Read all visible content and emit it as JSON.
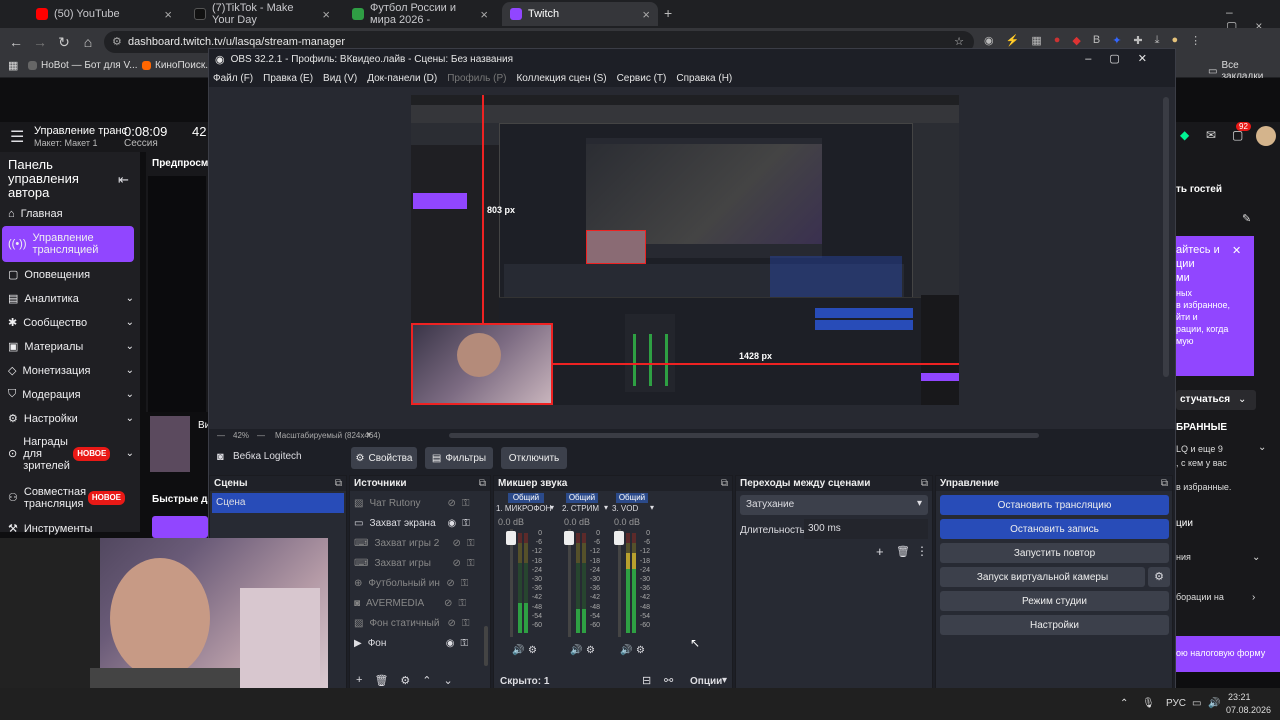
{
  "browser": {
    "tabs": [
      {
        "label": "(50) YouTube",
        "color": "#ff0000"
      },
      {
        "label": "(7)TikTok - Make Your Day",
        "color": "#111111"
      },
      {
        "label": "Футбол России и мира 2026 -",
        "color": "#2f9e44"
      },
      {
        "label": "Twitch",
        "color": "#9146ff"
      }
    ],
    "url": "dashboard.twitch.tv/u/lasqa/stream-manager",
    "bookmarks": [
      "HoBot — Бот для V...",
      "КиноПоиск.ru",
      "Все закладки"
    ]
  },
  "twitch": {
    "header_title": "Управление транс",
    "header_sub": "Макет: Макет 1",
    "session_time": "0:08:09",
    "session_label": "Сессия",
    "num42": "42",
    "preview_label": "Предпросм",
    "fast_label": "Быстрые де",
    "panel_title": "Панель управления автора",
    "side_items": [
      {
        "label": "Главная",
        "icon": "home-icon"
      },
      {
        "label": "Управление трансляцией",
        "icon": "stream-icon"
      },
      {
        "label": "Оповещения",
        "icon": "alert-icon"
      },
      {
        "label": "Аналитика",
        "icon": "chart-icon"
      },
      {
        "label": "Сообщество",
        "icon": "community-icon"
      },
      {
        "label": "Материалы",
        "icon": "content-icon"
      },
      {
        "label": "Монетизация",
        "icon": "money-icon"
      },
      {
        "label": "Модерация",
        "icon": "shield-icon"
      },
      {
        "label": "Настройки",
        "icon": "gear-icon"
      },
      {
        "label": "Награды для зрителей",
        "icon": "gift-icon"
      },
      {
        "label": "Совместная трансляция",
        "icon": "collab-icon"
      },
      {
        "label": "Инструменты",
        "icon": "tools-icon"
      }
    ],
    "new_badge": "НОВОЕ",
    "notifications": "92",
    "right_texts": {
      "guests": "ть гостей",
      "promo1": "айтесь и",
      "promo2": "ции",
      "promo3": "ми",
      "promo4": "ных",
      "promo5": "в избранное,",
      "promo6": "йти и",
      "promo7": "рации, когда",
      "promo8": "мую",
      "join": "стучаться",
      "fav": "БРАННЫЕ",
      "lq": "LQ и еще 9",
      "who": ", с кем у вас",
      "infav": "в избранные.",
      "tsii": "ции",
      "nia": "ния",
      "ration": "борации на",
      "tax": "ою налоговую форму"
    }
  },
  "obs": {
    "title": "OBS 32.2.1 - Профиль: ВКвидео.лайв - Сцены: Без названия",
    "menu": [
      "Файл (F)",
      "Правка (E)",
      "Вид (V)",
      "Док-панели (D)",
      "Профиль (P)",
      "Коллекция сцен (S)",
      "Сервис (T)",
      "Справка (H)"
    ],
    "dim_menu_index": 4,
    "preview_w": "803 px",
    "preview_h": "1428 px",
    "zoom": "42%",
    "scale_mode": "Масштабируемый (824x464)",
    "selected_source": "Вебка Logitech",
    "props_btn": "Свойства",
    "filters_btn": "Фильтры",
    "disable_btn": "Отключить",
    "scenes_title": "Сцены",
    "scenes": [
      "Сцена"
    ],
    "sources_title": "Источники",
    "sources": [
      {
        "label": "Чат Rutony",
        "icon": "image-icon",
        "dim": true
      },
      {
        "label": "Захват экрана",
        "icon": "monitor-icon",
        "dim": false
      },
      {
        "label": "Захват игры 2",
        "icon": "gamepad-icon",
        "dim": true
      },
      {
        "label": "Захват игры",
        "icon": "gamepad-icon",
        "dim": true
      },
      {
        "label": "Футбольный ин",
        "icon": "globe-icon",
        "dim": true
      },
      {
        "label": "AVERMEDIA",
        "icon": "camera-icon",
        "dim": true
      },
      {
        "label": "Фон статичный",
        "icon": "image-icon",
        "dim": true
      },
      {
        "label": "Фон",
        "icon": "play-icon",
        "dim": false
      }
    ],
    "mixer_title": "Микшер звука",
    "mixer_channels": [
      {
        "head": "Общий",
        "name": "1. МИКРОФОН",
        "db": "0.0 dB",
        "level": 0.35
      },
      {
        "head": "Общий",
        "name": "2. СТРИМ",
        "db": "0.0 dB",
        "level": 0.25
      },
      {
        "head": "Общий",
        "name": "3. VOD",
        "db": "0.0 dB",
        "level": 0.4
      }
    ],
    "scale_ticks": [
      "0",
      "-6",
      "-12",
      "-18",
      "-24",
      "-30",
      "-36",
      "-42",
      "-48",
      "-54",
      "-60"
    ],
    "hidden_label": "Скрыто: 1",
    "options_label": "Опции",
    "transitions_title": "Переходы между сценами",
    "transition_value": "Затухание",
    "duration_label": "Длительность",
    "duration_value": "300 ms",
    "controls_title": "Управление",
    "controls": [
      "Остановить трансляцию",
      "Остановить запись",
      "Запустить повтор",
      "Запуск виртуальной камеры",
      "Режим студии",
      "Настройки"
    ]
  },
  "taskbar": {
    "lang": "РУС",
    "time": "23:21",
    "date": "07.08.2026"
  }
}
